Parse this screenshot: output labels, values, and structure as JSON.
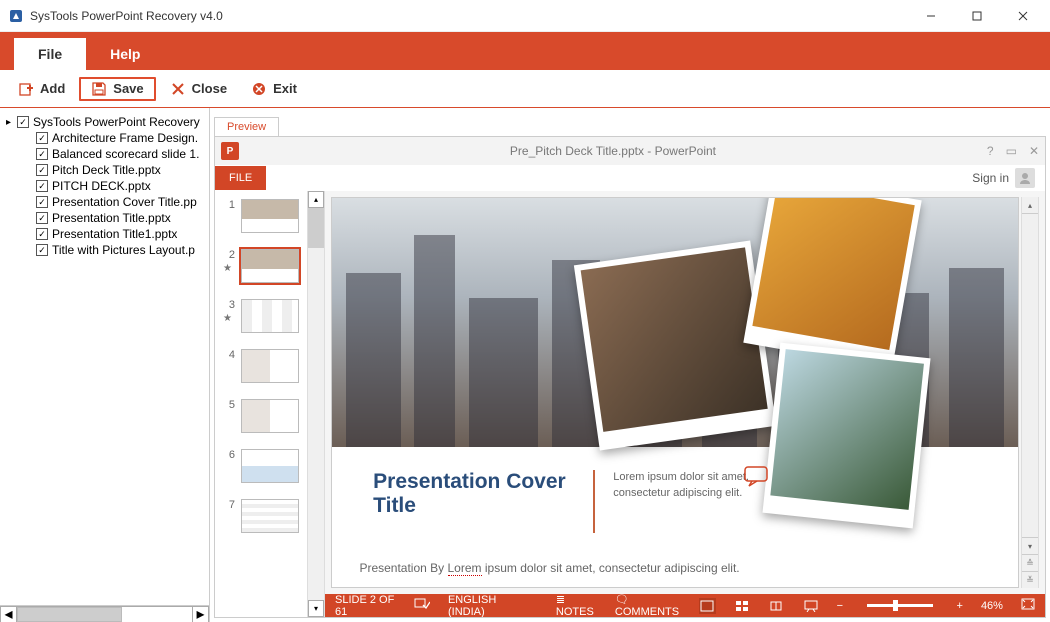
{
  "window": {
    "title": "SysTools PowerPoint Recovery v4.0"
  },
  "menu": {
    "file": "File",
    "help": "Help"
  },
  "toolbar": {
    "add": "Add",
    "save": "Save",
    "close": "Close",
    "exit": "Exit"
  },
  "tree": {
    "root": "SysTools PowerPoint Recovery",
    "items": [
      "Architecture Frame Design.",
      "Balanced scorecard slide 1.",
      "Pitch Deck Title.pptx",
      "PITCH DECK.pptx",
      "Presentation Cover Title.pp",
      "Presentation Title.pptx",
      "Presentation Title1.pptx",
      "Title with Pictures Layout.p"
    ]
  },
  "preview": {
    "tab": "Preview",
    "ppt": {
      "doc_title": "Pre_Pitch Deck Title.pptx - PowerPoint",
      "file_btn": "FILE",
      "signin": "Sign in",
      "slide_title_l1": "Presentation Cover",
      "slide_title_l2": "Title",
      "lorem": "Lorem ipsum dolor sit amet, consectetur adipiscing elit.",
      "byline_pre": "Presentation By ",
      "byline_u": "Lorem",
      "byline_post": " ipsum dolor sit amet, consectetur adipiscing elit.",
      "thumbs": [
        "1",
        "2",
        "3",
        "4",
        "5",
        "6",
        "7"
      ],
      "status": {
        "slide": "SLIDE 2 OF 61",
        "lang": "ENGLISH (INDIA)",
        "notes": "NOTES",
        "comments": "COMMENTS",
        "zoom": "46%"
      }
    }
  }
}
